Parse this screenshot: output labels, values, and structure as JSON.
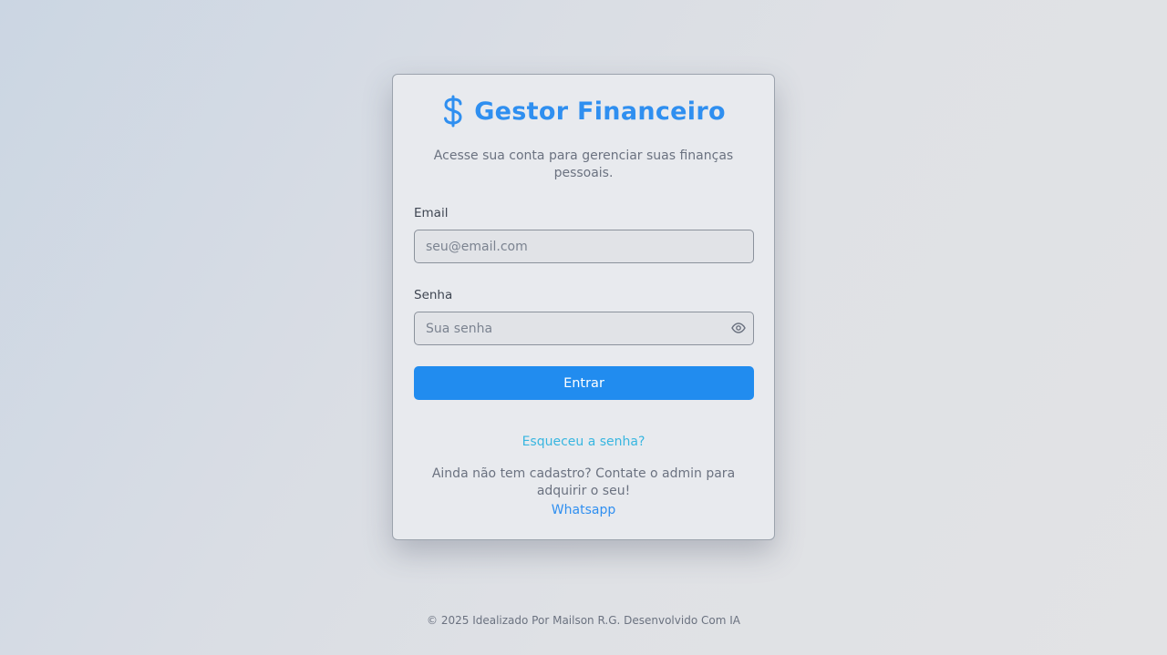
{
  "brand": {
    "icon": "dollar-sign-icon",
    "title": "Gestor Financeiro",
    "color": "#2f8ff0"
  },
  "subtitle": "Acesse sua conta para gerenciar suas finanças pessoais.",
  "form": {
    "email_label": "Email",
    "email_placeholder": "seu@email.com",
    "email_value": "",
    "password_label": "Senha",
    "password_placeholder": "Sua senha",
    "password_value": "",
    "password_toggle_icon": "eye-icon",
    "submit_label": "Entrar",
    "submit_color": "#218cef"
  },
  "links": {
    "forgot_password": "Esqueceu a senha?",
    "signup_text": "Ainda não tem cadastro? Contate o admin para adquirir o seu!",
    "whatsapp": "Whatsapp"
  },
  "footer": "© 2025 Idealizado Por Mailson R.G. Desenvolvido Com IA"
}
